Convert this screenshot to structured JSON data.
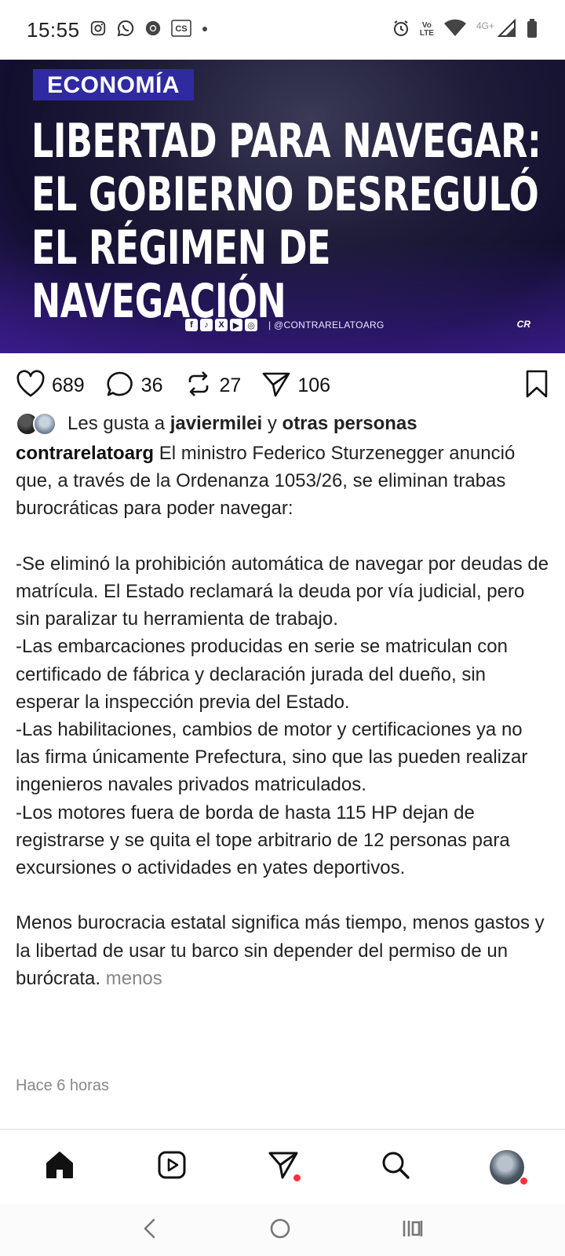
{
  "status_bar": {
    "time": "15:55",
    "left_icons": [
      "instagram-icon",
      "whatsapp-icon",
      "chrome-icon",
      "cs-icon",
      "dot-icon"
    ],
    "cs_label": "CS",
    "volte_label": "Vo))\nLTE",
    "network_label": "4G+",
    "right_icons": [
      "alarm-icon",
      "volte-icon",
      "wifi-icon",
      "signal-icon",
      "battery-icon"
    ]
  },
  "post_image": {
    "category": "ECONOMÍA",
    "headline": "LIBERTAD PARA NAVEGAR: EL GOBIERNO DESREGULÓ EL RÉGIMEN DE NAVEGACIÓN",
    "social_glyphs": [
      "f",
      "♪",
      "X",
      "▶",
      "◎"
    ],
    "handle": "| @CONTRARELATOARG",
    "logo": "CR"
  },
  "actions": {
    "likes": "689",
    "comments": "36",
    "reposts": "27",
    "shares": "106"
  },
  "likes_line": {
    "prefix": "Les gusta a",
    "user": "javiermilei",
    "conjunction": "y",
    "others": "otras personas"
  },
  "caption": {
    "username": "contrarelatoarg",
    "text": " El ministro Federico Sturzenegger anunció que, a través de la Ordenanza 1053/26, se eliminan trabas burocráticas para poder navegar:\n\n-Se eliminó la prohibición automática de navegar por deudas de matrícula. El Estado reclamará la deuda por vía judicial, pero sin paralizar tu herramienta de trabajo.\n-Las embarcaciones producidas en serie se matriculan con certificado de fábrica y declaración jurada del dueño, sin esperar la inspección previa del Estado.\n-Las habilitaciones, cambios de motor y certificaciones ya no las firma únicamente Prefectura, sino que las pueden realizar ingenieros navales privados matriculados.\n-Los motores fuera de borda de hasta 115 HP dejan de registrarse y se quita el tope arbitrario de 12 personas para excursiones o actividades en yates deportivos.\n\nMenos burocracia estatal significa más tiempo, menos gastos y la libertad de usar tu barco sin depender del permiso de un burócrata.",
    "more": " menos"
  },
  "timestamp": "Hace 6 horas",
  "bottom_nav": [
    "home-icon",
    "reels-icon",
    "direct-message-icon",
    "search-icon",
    "profile-avatar"
  ],
  "system_nav": [
    "back-icon",
    "home-circle-icon",
    "recent-apps-icon"
  ]
}
